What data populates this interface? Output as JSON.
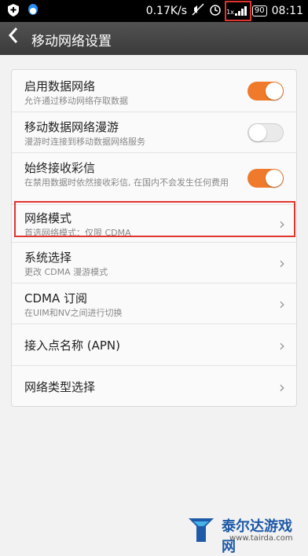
{
  "status": {
    "speed": "0.17K/s",
    "signal": "1x",
    "battery": "90",
    "time": "08:11"
  },
  "header": {
    "title": "移动网络设置"
  },
  "settings": [
    {
      "title": "启用数据网络",
      "subtitle": "允许通过移动网络存取数据",
      "toggle": "on"
    },
    {
      "title": "移动数据网络漫游",
      "subtitle": "漫游时连接到移动数据网络服务",
      "toggle": "off"
    },
    {
      "title": "始终接收彩信",
      "subtitle": "在禁用数据时依然接收彩信, 在国内不会发生任何费用",
      "toggle": "on"
    },
    {
      "title": "网络模式",
      "subtitle": "首选网络模式：仅限 CDMA"
    },
    {
      "title": "系统选择",
      "subtitle": "更改 CDMA 漫游模式"
    },
    {
      "title": "CDMA 订阅",
      "subtitle": "在UIM和NV之间进行切换"
    },
    {
      "title": "接入点名称 (APN)"
    },
    {
      "title": "网络类型选择"
    }
  ],
  "watermark": {
    "name": "泰尔达游戏网",
    "url": "www.tairda.com"
  },
  "colors": {
    "accent": "#f07a2b",
    "highlight": "#e0342f"
  }
}
